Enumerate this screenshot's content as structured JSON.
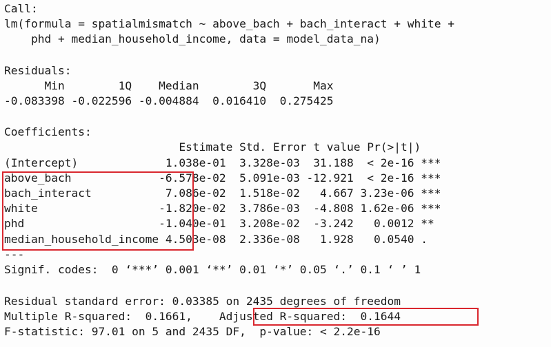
{
  "console": {
    "lines": [
      "Call:",
      "lm(formula = spatialmismatch ~ above_bach + bach_interact + white +",
      "    phd + median_household_income, data = model_data_na)",
      "",
      "Residuals:",
      "      Min        1Q    Median        3Q       Max",
      "-0.083398 -0.022596 -0.004884  0.016410  0.275425",
      "",
      "Coefficients:",
      "                          Estimate Std. Error t value Pr(>|t|)",
      "(Intercept)             1.038e-01  3.328e-03  31.188  < 2e-16 ***",
      "above_bach             -6.578e-02  5.091e-03 -12.921  < 2e-16 ***",
      "bach_interact           7.086e-02  1.518e-02   4.667 3.23e-06 ***",
      "white                  -1.820e-02  3.786e-03  -4.808 1.62e-06 ***",
      "phd                    -1.040e-01  3.208e-02  -3.242   0.0012 **",
      "median_household_income 4.503e-08  2.336e-08   1.928   0.0540 .",
      "---",
      "Signif. codes:  0 ‘***’ 0.001 ‘**’ 0.01 ‘*’ 0.05 ‘.’ 0.1 ‘ ’ 1",
      "",
      "Residual standard error: 0.03385 on 2435 degrees of freedom",
      "Multiple R-squared:  0.1661,\tAdjusted R-squared:  0.1644",
      "F-statistic: 97.01 on 5 and 2435 DF,  p-value: < 2.2e-16"
    ]
  },
  "highlight_color": "#d9272e"
}
